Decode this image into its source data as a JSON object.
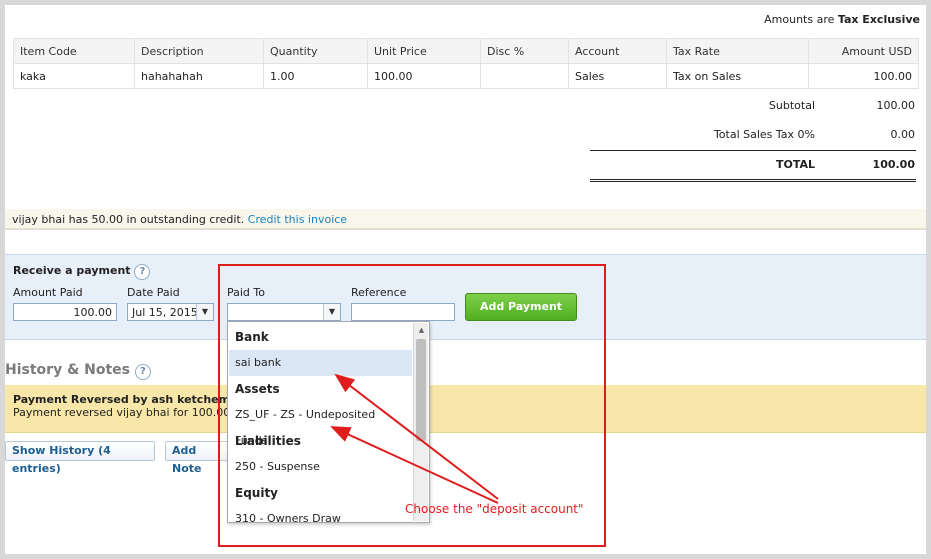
{
  "tax_mode": {
    "prefix": "Amounts are",
    "value": "Tax Exclusive"
  },
  "items_table": {
    "headers": [
      "Item Code",
      "Description",
      "Quantity",
      "Unit Price",
      "Disc %",
      "Account",
      "Tax Rate",
      "Amount USD"
    ],
    "rows": [
      [
        "kaka",
        "hahahahah",
        "1.00",
        "100.00",
        "",
        "Sales",
        "Tax on Sales",
        "100.00"
      ]
    ]
  },
  "totals": {
    "subtotal_label": "Subtotal",
    "subtotal": "100.00",
    "tax_label": "Total Sales Tax 0%",
    "tax": "0.00",
    "total_label": "TOTAL",
    "total": "100.00"
  },
  "credit": {
    "text": "vijay bhai has 50.00 in outstanding credit.",
    "link": "Credit this invoice"
  },
  "payment": {
    "title": "Receive a payment",
    "amount_label": "Amount Paid",
    "amount": "100.00",
    "date_label": "Date Paid",
    "date": "Jul 15, 2015",
    "paid_to_label": "Paid To",
    "paid_to": "",
    "reference_label": "Reference",
    "reference": "",
    "add_button": "Add Payment"
  },
  "dropdown": {
    "options": [
      {
        "label": "Bank",
        "group": true
      },
      {
        "label": "sai bank",
        "group": false,
        "highlighted": true
      },
      {
        "label": "Assets",
        "group": true
      },
      {
        "label": "ZS_UF - ZS - Undeposited Funds",
        "group": false
      },
      {
        "label": "Liabilities",
        "group": true
      },
      {
        "label": "250 - Suspense",
        "group": false
      },
      {
        "label": "Equity",
        "group": true
      },
      {
        "label": "310 - Owners Draw",
        "group": false
      }
    ]
  },
  "history": {
    "title": "History & Notes",
    "entry_title": "Payment Reversed by ash ketchem on",
    "entry_detail": "Payment reversed vijay bhai for 100.00.",
    "show_history": "Show History (4 entries)",
    "add_note": "Add Note"
  },
  "annotation": {
    "text": "Choose the \"deposit account\""
  },
  "colors": {
    "annotation_red": "#e01d1d",
    "link_blue": "#1e7fb8",
    "button_green": "#4fae21",
    "panel_blue": "#e7eff9",
    "history_yellow": "#f8e7a9"
  },
  "icons": {
    "help": "question-circle-icon",
    "select": "chevron-down-icon"
  }
}
